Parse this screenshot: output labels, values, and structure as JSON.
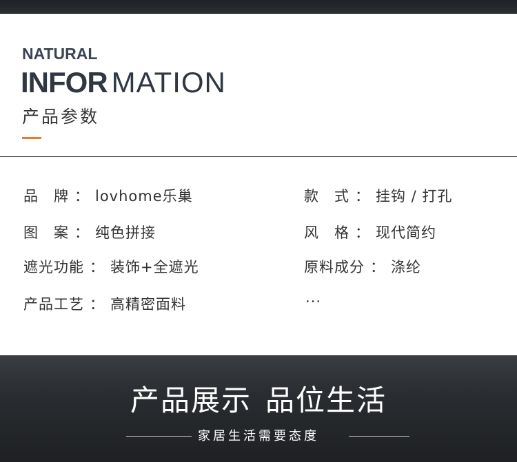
{
  "header": {
    "eyebrow": "NATURAL",
    "headline_bold": "INFOR",
    "headline_light": "MATION",
    "section_title": "产品参数",
    "accent_color": "#f07a2a"
  },
  "specs": {
    "colon": "：",
    "items": [
      {
        "key": "品　牌",
        "value": "lovhome乐巢"
      },
      {
        "key": "款　式",
        "value": "挂钩 / 打孔"
      },
      {
        "key": "图　案",
        "value": "纯色拼接"
      },
      {
        "key": "风　格",
        "value": "现代简约"
      },
      {
        "key": "遮光功能",
        "value": "装饰+全遮光"
      },
      {
        "key": "原料成分",
        "value": "涤纶"
      },
      {
        "key": "产品工艺",
        "value": "高精密面料"
      }
    ],
    "more": "···"
  },
  "banner": {
    "title_part1": "产品展示",
    "title_part2": "品位生活",
    "subtitle": "家居生活需要态度"
  }
}
